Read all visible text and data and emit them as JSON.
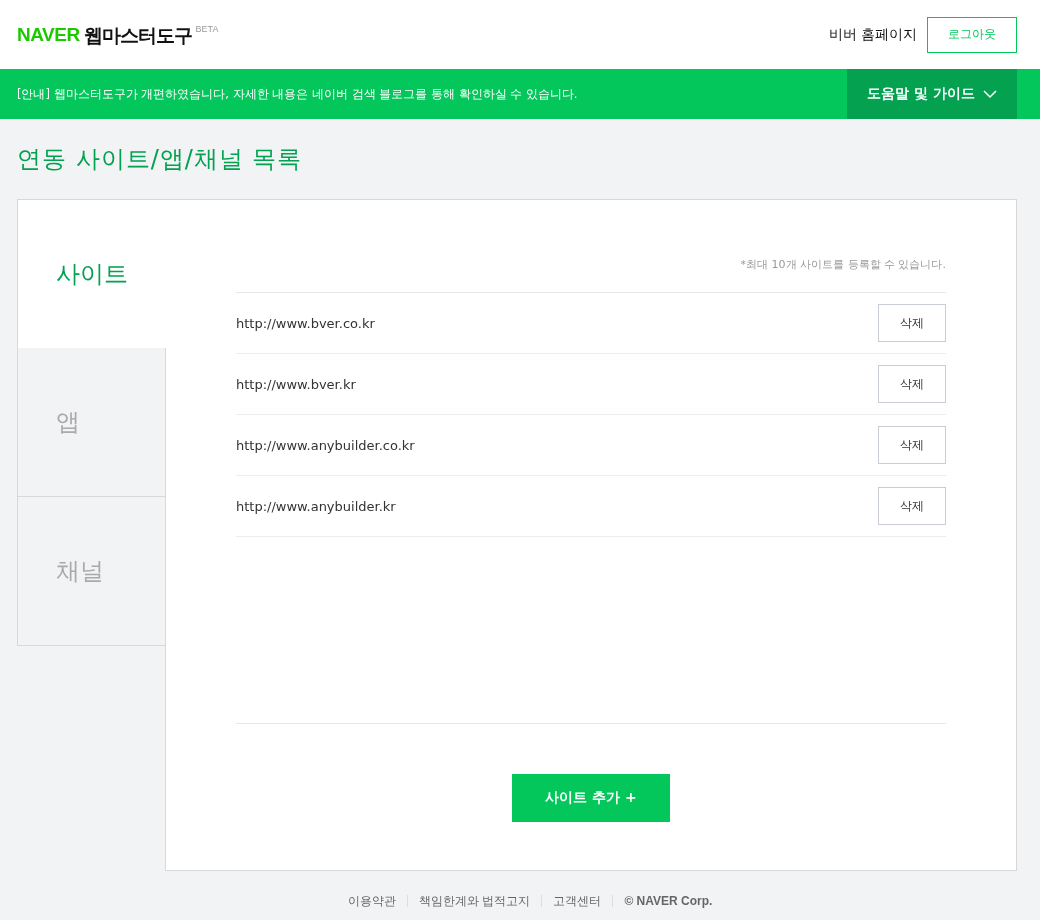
{
  "header": {
    "logo": "NAVER",
    "service_name": "웹마스터도구",
    "badge": "BETA",
    "homepage_link": "비버 홈페이지",
    "logout_button": "로그아웃"
  },
  "notice_bar": {
    "text": "[안내] 웹마스터도구가 개편하였습니다, 자세한 내용은 네이버 검색 블로그를 통해 확인하실 수 있습니다.",
    "help_menu": "도움말 및 가이드"
  },
  "page_title": "연동 사이트/앱/채널 목록",
  "tabs": [
    {
      "label": "사이트",
      "selected": true
    },
    {
      "label": "앱",
      "selected": false
    },
    {
      "label": "채널",
      "selected": false
    }
  ],
  "limit_note": "*최대 10개 사이트를 등록할 수 있습니다.",
  "sites": [
    {
      "url": "http://www.bver.co.kr",
      "delete_button": "삭제"
    },
    {
      "url": "http://www.bver.kr",
      "delete_button": "삭제"
    },
    {
      "url": "http://www.anybuilder.co.kr",
      "delete_button": "삭제"
    },
    {
      "url": "http://www.anybuilder.kr",
      "delete_button": "삭제"
    }
  ],
  "add_button": "사이트 추가 +",
  "footer": {
    "links": [
      "이용약관",
      "책임한계와 법적고지",
      "고객센터"
    ],
    "copyright": "© NAVER Corp."
  }
}
